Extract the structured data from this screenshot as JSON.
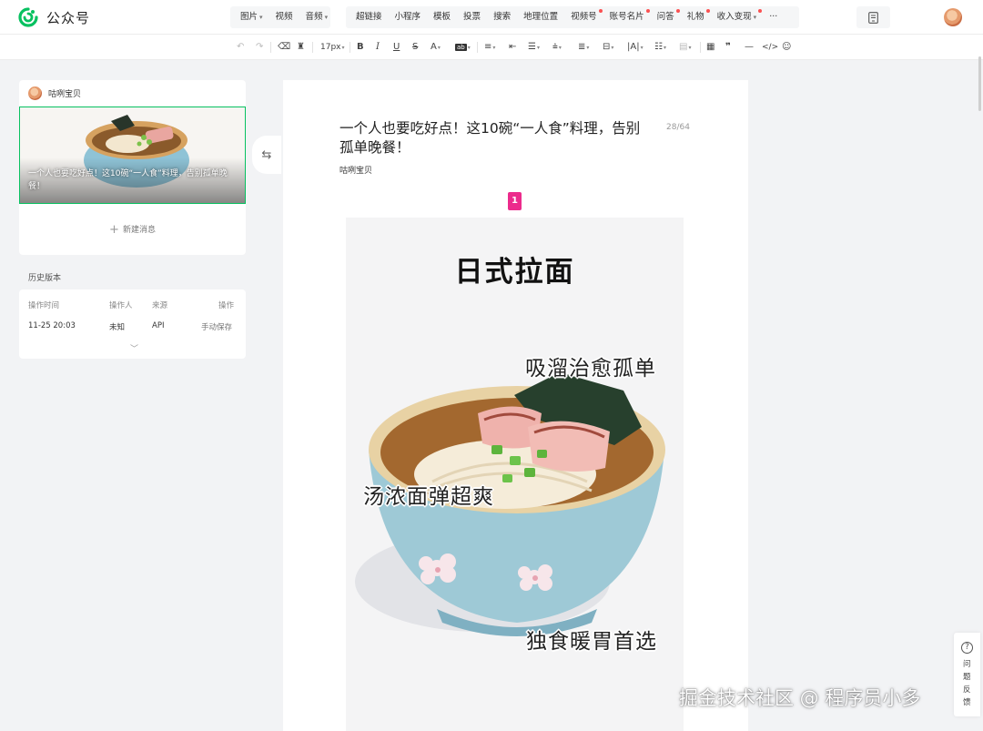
{
  "brand": {
    "name": "公众号",
    "accent": "#07c160"
  },
  "menu_media": [
    {
      "label": "图片",
      "caret": true,
      "dot": false
    },
    {
      "label": "视频",
      "caret": false,
      "dot": false
    },
    {
      "label": "音频",
      "caret": true,
      "dot": false
    }
  ],
  "menu_tools": [
    {
      "label": "超链接",
      "caret": false,
      "dot": false
    },
    {
      "label": "小程序",
      "caret": false,
      "dot": false
    },
    {
      "label": "模板",
      "caret": false,
      "dot": false
    },
    {
      "label": "投票",
      "caret": false,
      "dot": false
    },
    {
      "label": "搜索",
      "caret": false,
      "dot": false
    },
    {
      "label": "地理位置",
      "caret": false,
      "dot": false
    },
    {
      "label": "视频号",
      "caret": false,
      "dot": true
    },
    {
      "label": "账号名片",
      "caret": false,
      "dot": true
    },
    {
      "label": "问答",
      "caret": false,
      "dot": true
    },
    {
      "label": "礼物",
      "caret": false,
      "dot": true
    },
    {
      "label": "收入变现",
      "caret": true,
      "dot": true
    },
    {
      "label": "···",
      "caret": false,
      "dot": false
    }
  ],
  "format_toolbar": {
    "font_size": "17px"
  },
  "article_card": {
    "author": "咕咧宝贝",
    "thumb_title": "一个人也要吃好点！这10碗“一人食”料理，告别孤单晚餐！",
    "new_message": "新建消息"
  },
  "history": {
    "title": "历史版本",
    "headers": [
      "操作时间",
      "操作人",
      "来源",
      "操作"
    ],
    "rows": [
      {
        "time": "11-25 20:03",
        "operator": "未知",
        "source": "API",
        "action": "手动保存"
      }
    ]
  },
  "editor": {
    "title": "一个人也要吃好点！这10碗“一人食”料理，告别孤单晚餐！",
    "title_count": "28/64",
    "author": "咕咧宝贝",
    "page_badge": "1",
    "badge_color": "#ec2b8c",
    "image": {
      "heading": "日式拉面",
      "caption_1": "吸溜治愈孤单",
      "caption_2": "汤浓面弹超爽",
      "caption_3": "独食暖胃首选"
    }
  },
  "feedback": {
    "label": "问题反馈",
    "icon": "question-icon"
  },
  "watermark": "掘金技术社区 @ 程序员小多"
}
